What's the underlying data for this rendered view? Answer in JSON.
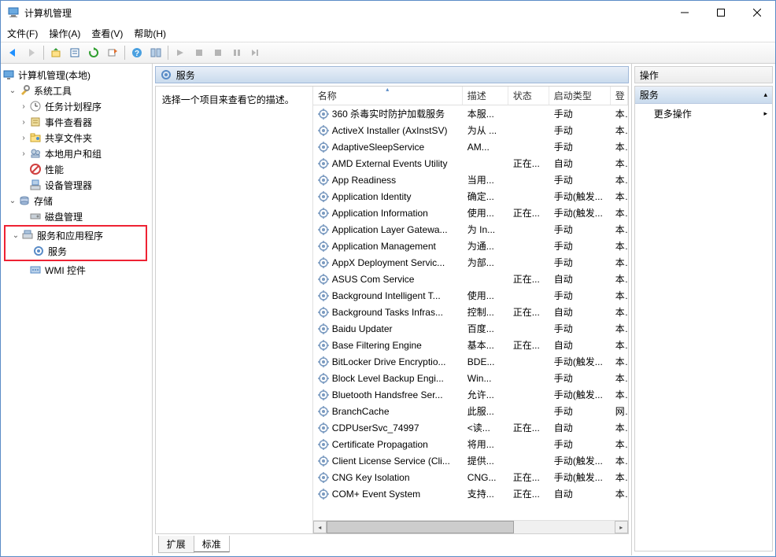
{
  "window": {
    "title": "计算机管理"
  },
  "menu": {
    "file": "文件(F)",
    "action": "操作(A)",
    "view": "查看(V)",
    "help": "帮助(H)"
  },
  "tree": {
    "root": "计算机管理(本地)",
    "systools": "系统工具",
    "systools_items": [
      "任务计划程序",
      "事件查看器",
      "共享文件夹",
      "本地用户和组",
      "性能",
      "设备管理器"
    ],
    "storage": "存储",
    "storage_items": [
      "磁盘管理"
    ],
    "svcapp": "服务和应用程序",
    "svcapp_items": [
      "服务",
      "WMI 控件"
    ]
  },
  "center": {
    "header": "服务",
    "desc_hint": "选择一个项目来查看它的描述。",
    "columns": {
      "name": "名称",
      "desc": "描述",
      "status": "状态",
      "startup": "启动类型",
      "logon": "登"
    },
    "tabs": {
      "extended": "扩展",
      "standard": "标准"
    }
  },
  "services": [
    {
      "name": "360 杀毒实时防护加载服务",
      "desc": "本服...",
      "status": "",
      "startup": "手动",
      "logon": "本"
    },
    {
      "name": "ActiveX Installer (AxInstSV)",
      "desc": "为从 ...",
      "status": "",
      "startup": "手动",
      "logon": "本"
    },
    {
      "name": "AdaptiveSleepService",
      "desc": "AM...",
      "status": "",
      "startup": "手动",
      "logon": "本"
    },
    {
      "name": "AMD External Events Utility",
      "desc": "",
      "status": "正在...",
      "startup": "自动",
      "logon": "本"
    },
    {
      "name": "App Readiness",
      "desc": "当用...",
      "status": "",
      "startup": "手动",
      "logon": "本"
    },
    {
      "name": "Application Identity",
      "desc": "确定...",
      "status": "",
      "startup": "手动(触发...",
      "logon": "本"
    },
    {
      "name": "Application Information",
      "desc": "使用...",
      "status": "正在...",
      "startup": "手动(触发...",
      "logon": "本"
    },
    {
      "name": "Application Layer Gatewa...",
      "desc": "为 In...",
      "status": "",
      "startup": "手动",
      "logon": "本"
    },
    {
      "name": "Application Management",
      "desc": "为通...",
      "status": "",
      "startup": "手动",
      "logon": "本"
    },
    {
      "name": "AppX Deployment Servic...",
      "desc": "为部...",
      "status": "",
      "startup": "手动",
      "logon": "本"
    },
    {
      "name": "ASUS Com Service",
      "desc": "",
      "status": "正在...",
      "startup": "自动",
      "logon": "本"
    },
    {
      "name": "Background Intelligent T...",
      "desc": "使用...",
      "status": "",
      "startup": "手动",
      "logon": "本"
    },
    {
      "name": "Background Tasks Infras...",
      "desc": "控制...",
      "status": "正在...",
      "startup": "自动",
      "logon": "本"
    },
    {
      "name": "Baidu Updater",
      "desc": "百度...",
      "status": "",
      "startup": "手动",
      "logon": "本"
    },
    {
      "name": "Base Filtering Engine",
      "desc": "基本...",
      "status": "正在...",
      "startup": "自动",
      "logon": "本"
    },
    {
      "name": "BitLocker Drive Encryptio...",
      "desc": "BDE...",
      "status": "",
      "startup": "手动(触发...",
      "logon": "本"
    },
    {
      "name": "Block Level Backup Engi...",
      "desc": "Win...",
      "status": "",
      "startup": "手动",
      "logon": "本"
    },
    {
      "name": "Bluetooth Handsfree Ser...",
      "desc": "允许...",
      "status": "",
      "startup": "手动(触发...",
      "logon": "本"
    },
    {
      "name": "BranchCache",
      "desc": "此服...",
      "status": "",
      "startup": "手动",
      "logon": "网"
    },
    {
      "name": "CDPUserSvc_74997",
      "desc": "<读...",
      "status": "正在...",
      "startup": "自动",
      "logon": "本"
    },
    {
      "name": "Certificate Propagation",
      "desc": "将用...",
      "status": "",
      "startup": "手动",
      "logon": "本"
    },
    {
      "name": "Client License Service (Cli...",
      "desc": "提供...",
      "status": "",
      "startup": "手动(触发...",
      "logon": "本"
    },
    {
      "name": "CNG Key Isolation",
      "desc": "CNG...",
      "status": "正在...",
      "startup": "手动(触发...",
      "logon": "本"
    },
    {
      "name": "COM+ Event System",
      "desc": "支持...",
      "status": "正在...",
      "startup": "自动",
      "logon": "本"
    }
  ],
  "actions": {
    "header": "操作",
    "section": "服务",
    "more": "更多操作"
  },
  "colwidths": {
    "name": "190px",
    "desc": "58px",
    "status": "52px",
    "startup": "78px",
    "logon": "22px"
  }
}
